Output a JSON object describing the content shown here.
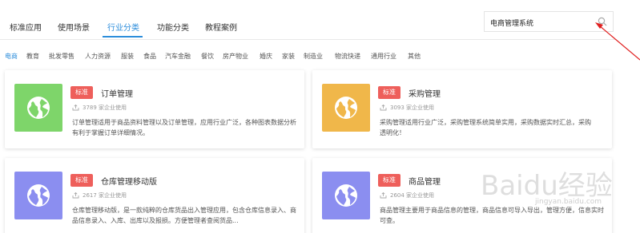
{
  "tabs": [
    {
      "label": "标准应用"
    },
    {
      "label": "使用场景"
    },
    {
      "label": "行业分类"
    },
    {
      "label": "功能分类"
    },
    {
      "label": "教程案例"
    }
  ],
  "active_tab_index": 2,
  "search": {
    "value": "电商管理系统"
  },
  "categories": [
    {
      "label": "电商"
    },
    {
      "label": "教育"
    },
    {
      "label": "批发零售"
    },
    {
      "label": "人力资源"
    },
    {
      "label": "服装"
    },
    {
      "label": "食品"
    },
    {
      "label": "汽车金融"
    },
    {
      "label": "餐饮"
    },
    {
      "label": "房产物业"
    },
    {
      "label": "婚庆"
    },
    {
      "label": "家装"
    },
    {
      "label": "制造业"
    },
    {
      "label": "物流快递"
    },
    {
      "label": "通用行业"
    },
    {
      "label": "其他"
    }
  ],
  "active_category_index": 0,
  "cards": [
    {
      "badge": "标准",
      "title": "订单管理",
      "usage": "3789 家企业使用",
      "desc": "订单管理适用于商品资料管理以及订单管理，应用行业广泛，各种图表数据分析有利于掌握订单详细情况。",
      "color": "#7ed56a"
    },
    {
      "badge": "标准",
      "title": "采购管理",
      "usage": "3093 家企业使用",
      "desc": "采购管理适用行业广泛，采购管理系统简单实用，采购数据实时汇总，采购透明化！",
      "color": "#f0b74a"
    },
    {
      "badge": "标准",
      "title": "仓库管理移动版",
      "usage": "2617 家企业使用",
      "desc": "仓库管理移动版，是一款纯粹的仓库货品出入管理应用，包含仓库信息录入、商品信息录入、入库、出库以及报损。方便管理者查阅货品...",
      "color": "#8b8ef0"
    },
    {
      "badge": "标准",
      "title": "商品管理",
      "usage": "2604 家企业使用",
      "desc": "商品管理主要用于商品信息的管理，商品信息可导入导出，管理方便，信息实时可查。",
      "color": "#8b8ef0"
    }
  ],
  "watermark": {
    "main": "Baidu经验",
    "sub": "jingyan.baidu.com"
  },
  "colors": {
    "accent": "#2c8ddb",
    "badge": "#ee5f5b",
    "arrow": "#e02020"
  },
  "icons": {
    "search": "search-icon",
    "card": "globe-icon",
    "usage": "usage-icon"
  }
}
